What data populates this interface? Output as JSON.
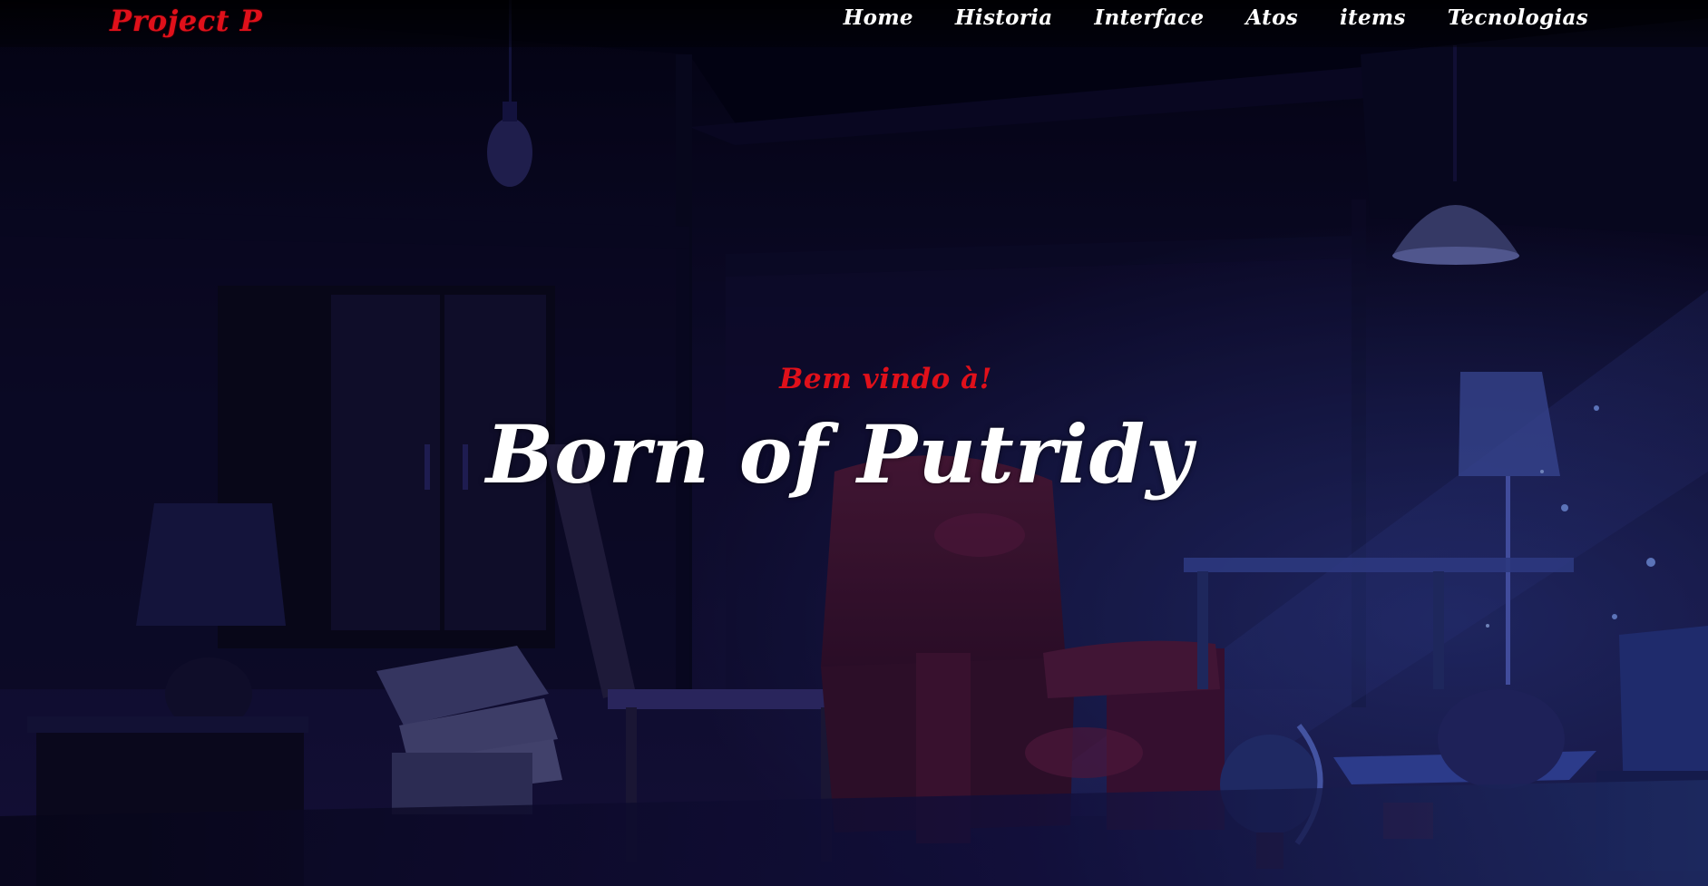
{
  "brand": {
    "label": "Project P"
  },
  "nav": {
    "items": [
      {
        "label": "Home"
      },
      {
        "label": "Historia"
      },
      {
        "label": "Interface"
      },
      {
        "label": "Atos"
      },
      {
        "label": "items"
      },
      {
        "label": "Tecnologias"
      }
    ]
  },
  "hero": {
    "welcome": "Bem vindo à!",
    "title": "Born of Putridy"
  },
  "colors": {
    "accent": "#e0101a",
    "background": "#07061a",
    "scene": "#1e1a52",
    "text": "#ffffff"
  },
  "icons": {
    "background": "attic-room-illustration",
    "bulb": "light-bulb-icon",
    "lamp": "ceiling-lamp-icon"
  }
}
